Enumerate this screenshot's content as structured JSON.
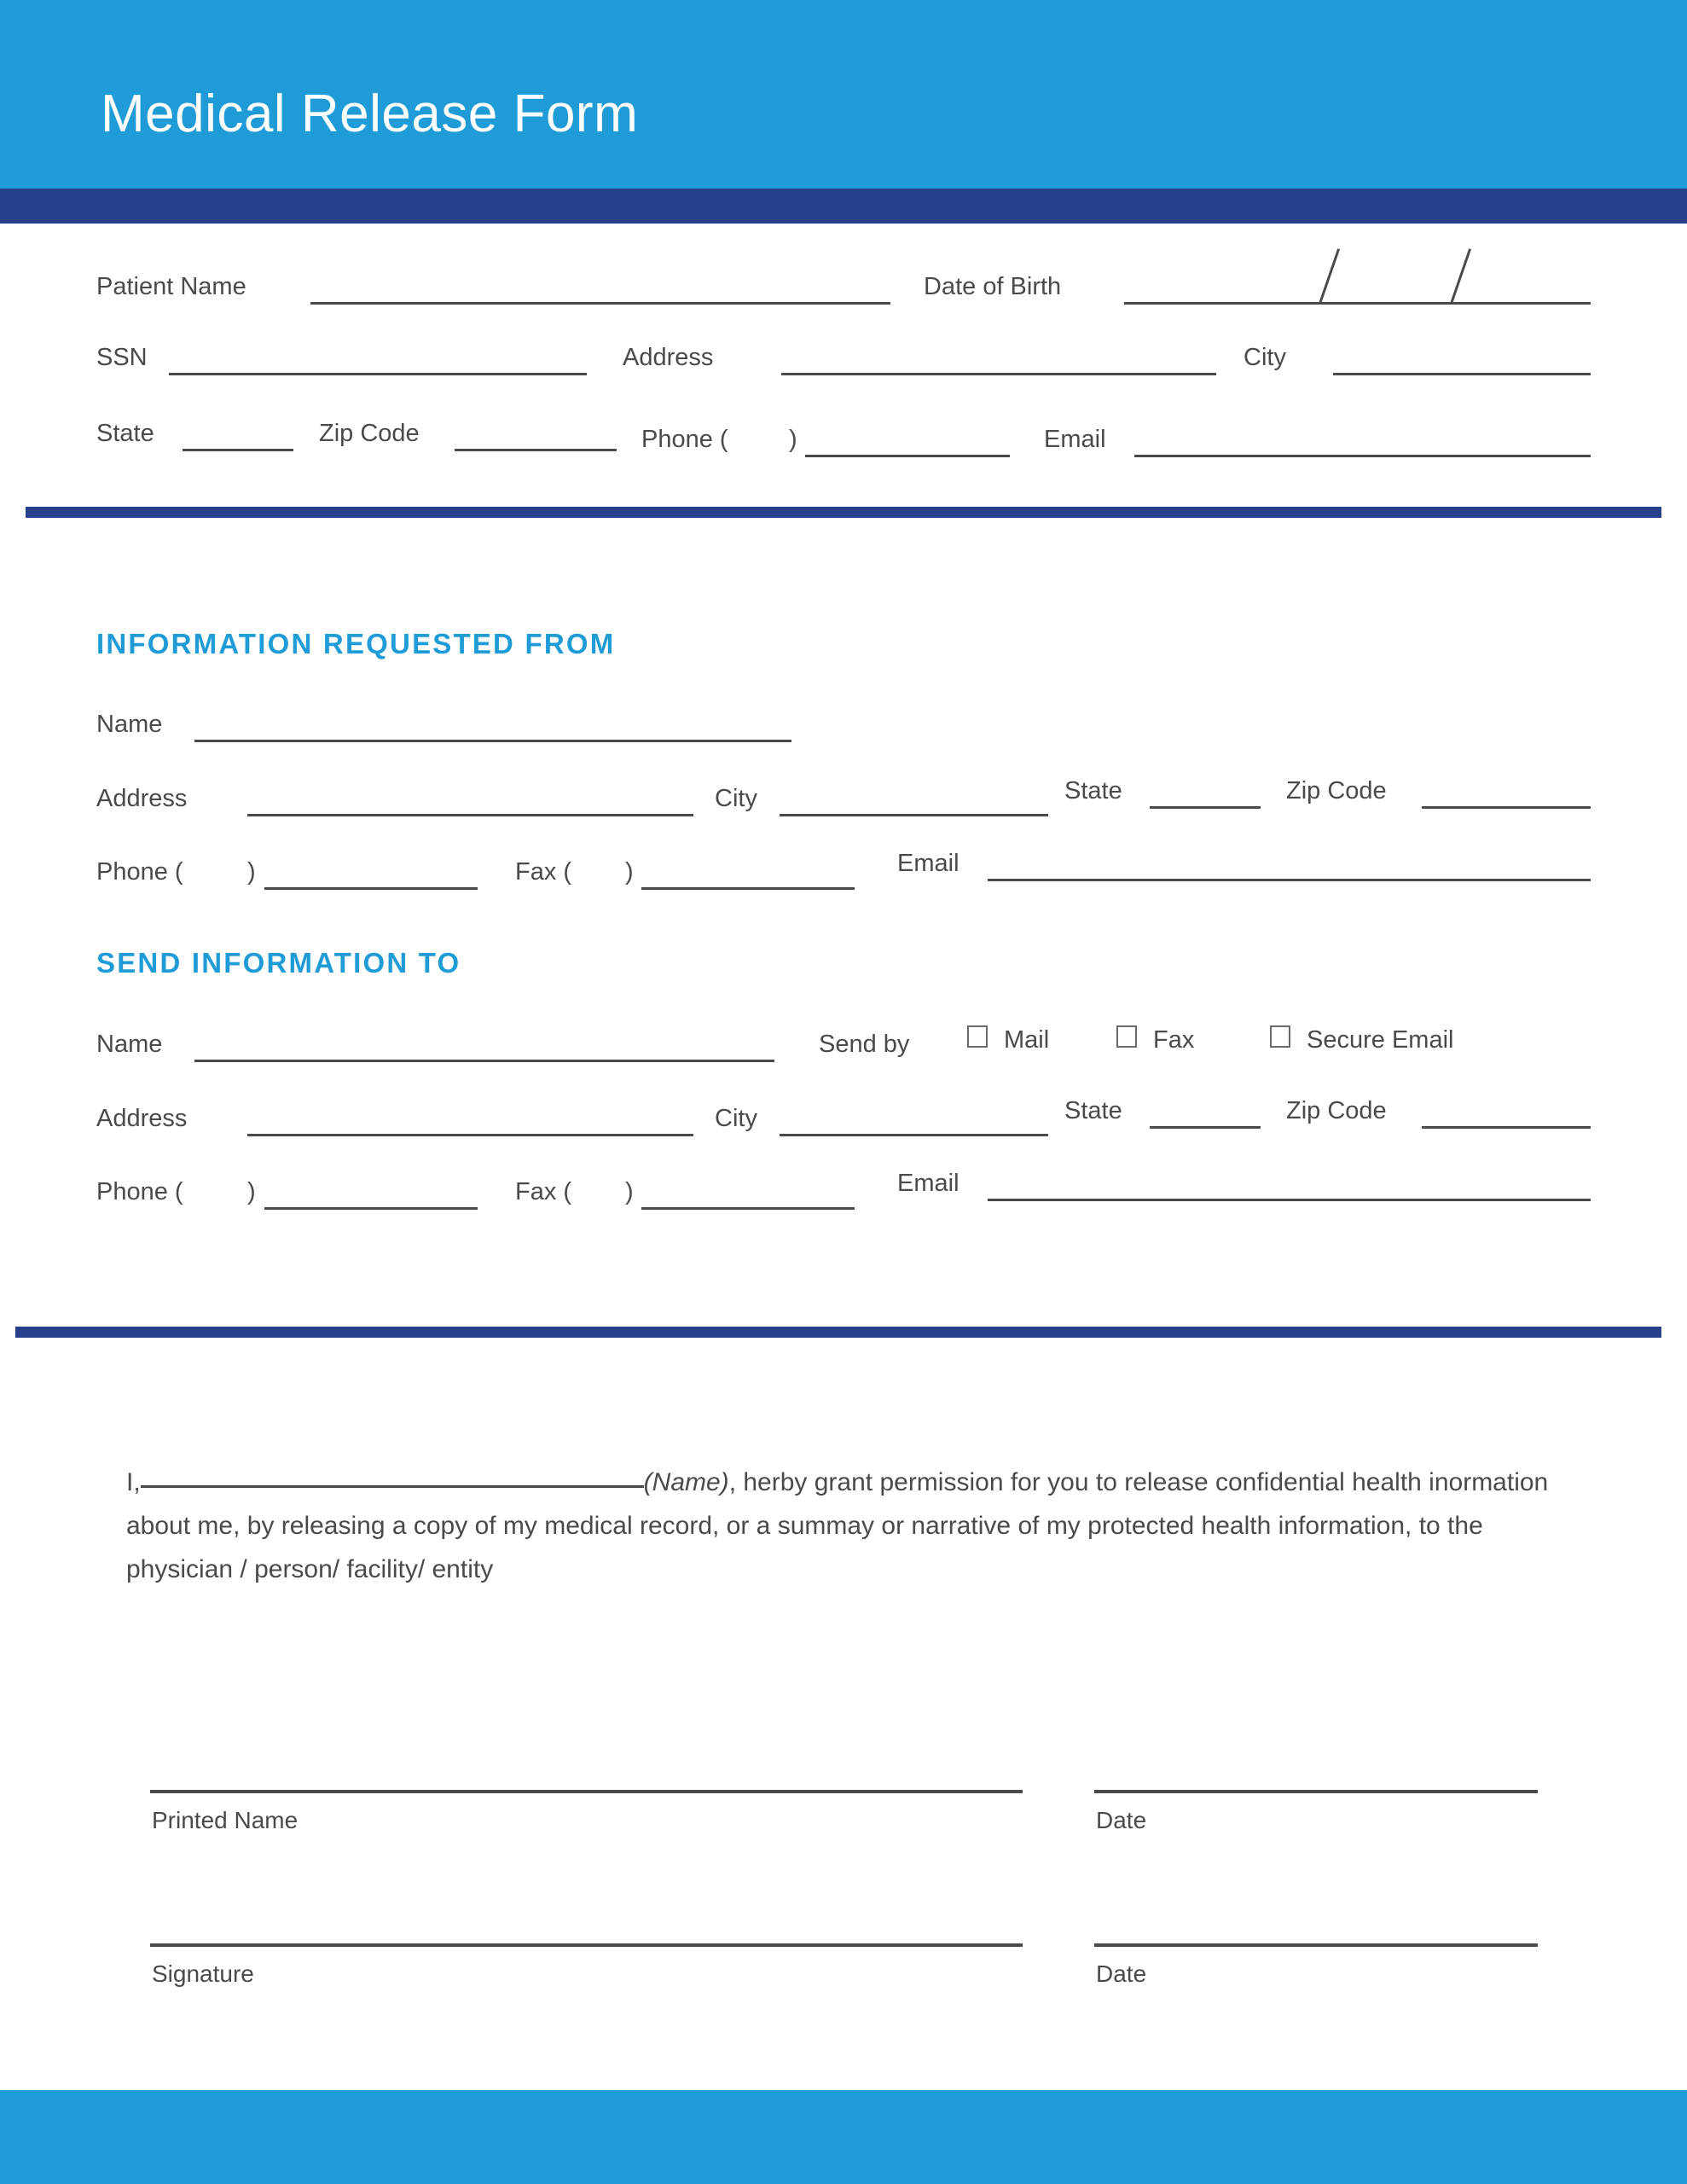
{
  "header": {
    "title": "Medical Release Form",
    "band_color": "#1f9cd7",
    "underbar_color": "#27408b"
  },
  "patient_section": {
    "patient_name_label": "Patient Name",
    "dob_label": "Date of Birth",
    "ssn_label": "SSN",
    "address_label": "Address",
    "city_label": "City",
    "state_label": "State",
    "zip_label": "Zip Code",
    "phone_label": "Phone (",
    "phone_label_close": ")",
    "email_label": "Email"
  },
  "requested_from": {
    "heading": "INFORMATION REQUESTED FROM",
    "name_label": "Name",
    "address_label": "Address",
    "city_label": "City",
    "state_label": "State",
    "zip_label": "Zip Code",
    "phone_label": "Phone (",
    "phone_label_close": ")",
    "fax_label": "Fax (",
    "fax_label_close": ")",
    "email_label": "Email"
  },
  "send_to": {
    "heading": "SEND INFORMATION TO",
    "name_label": "Name",
    "send_by_label": "Send by",
    "options": [
      {
        "label": "Mail",
        "checked": false
      },
      {
        "label": "Fax",
        "checked": false
      },
      {
        "label": "Secure Email",
        "checked": false
      }
    ],
    "address_label": "Address",
    "city_label": "City",
    "state_label": "State",
    "zip_label": "Zip Code",
    "phone_label": "Phone (",
    "phone_label_close": ")",
    "fax_label": "Fax (",
    "fax_label_close": ")",
    "email_label": "Email"
  },
  "consent": {
    "lead": "I,",
    "name_marker": "(Name)",
    "line1_rest": ", herby grant permission for you to release confidential",
    "line2": "health inormation about me, by releasing a copy of my medical record, or a summay or narrative of",
    "line3": "my protected health information, to the physician / person/ facility/ entity"
  },
  "signature_block": {
    "printed_name_label": "Printed Name",
    "printed_name_date_label": "Date",
    "signature_label": "Signature",
    "signature_date_label": "Date"
  },
  "colors": {
    "brand_light_blue": "#1f9cd7",
    "brand_dark_blue": "#27408b",
    "text_gray": "#4a4a4a"
  }
}
